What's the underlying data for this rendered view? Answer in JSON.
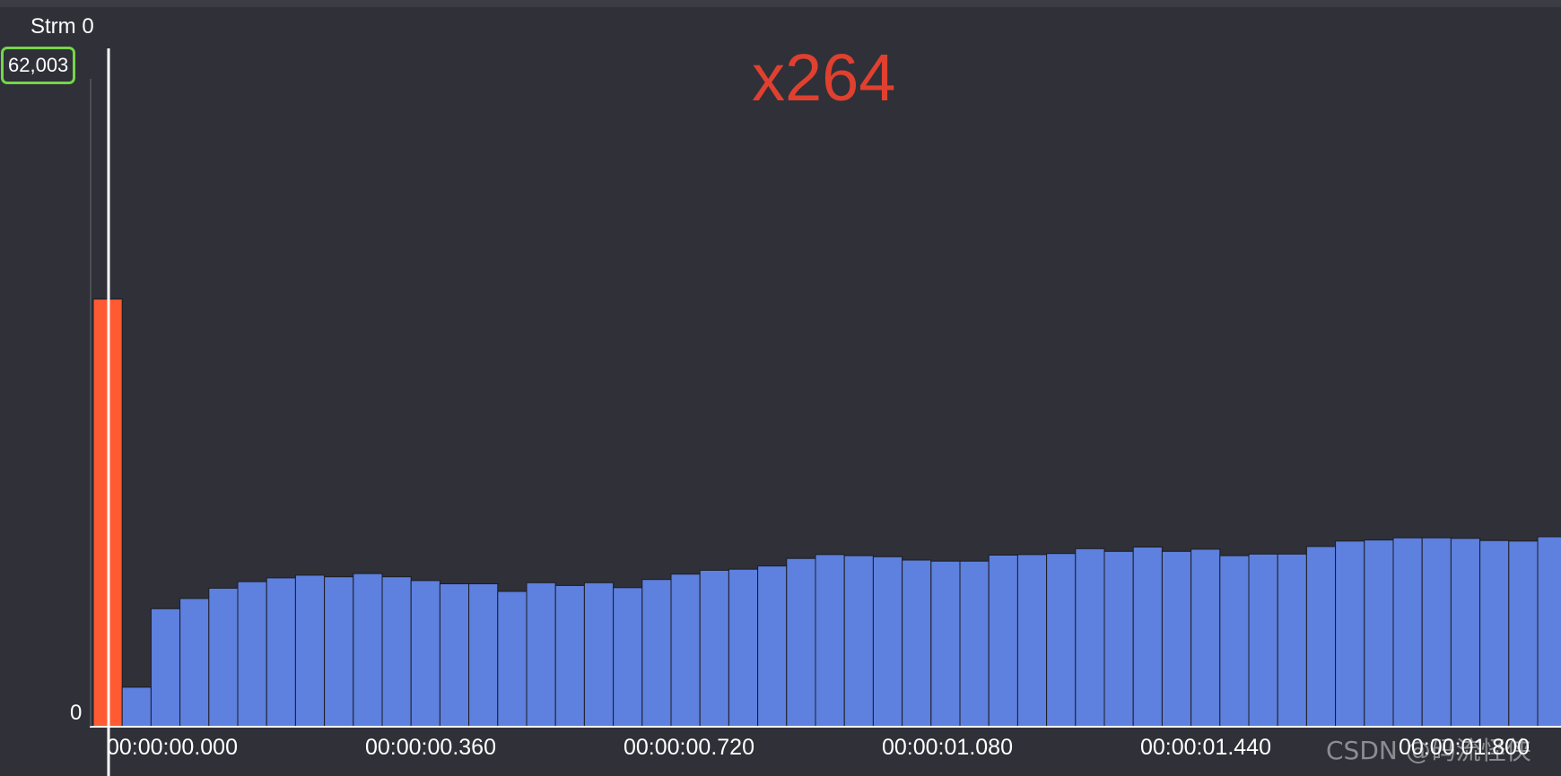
{
  "stream_label": "Strm 0",
  "max_value_label": "62,003",
  "zero_label": "0",
  "annotation": "x264",
  "watermark": "CSDN @码流怪侠",
  "colors": {
    "background": "#2f3038",
    "i_frame": "#ff5a32",
    "p_frame": "#5e80de",
    "annotation": "#e0402f",
    "badge_border": "#74d64a",
    "axis": "#ffffff"
  },
  "chart_data": {
    "type": "bar",
    "title": "",
    "xlabel": "",
    "ylabel": "",
    "ylim": [
      0,
      62003
    ],
    "x_tick_labels": [
      "00:00:00.000",
      "00:00:00.360",
      "00:00:00.720",
      "00:00:01.080",
      "00:00:01.440",
      "00:00:01.800"
    ],
    "series": [
      {
        "frame_type": "I",
        "color": "#ff5a32",
        "values": [
          39500
        ]
      },
      {
        "frame_type": "P",
        "color": "#5e80de",
        "values": [
          3650,
          10900,
          11850,
          12800,
          13400,
          13750,
          14000,
          13850,
          14150,
          13850,
          13500,
          13200,
          13200,
          12500,
          13300,
          13050,
          13300,
          12850,
          13600,
          14100,
          14450,
          14550,
          14850,
          15550,
          15900,
          15800,
          15700,
          15400,
          15300,
          15300,
          15850,
          15900,
          16000,
          16450,
          16200,
          16600,
          16200,
          16400,
          15800,
          15950,
          15950,
          16650,
          17150,
          17250,
          17450,
          17450,
          17400,
          17200,
          17150,
          17550
        ]
      }
    ]
  }
}
